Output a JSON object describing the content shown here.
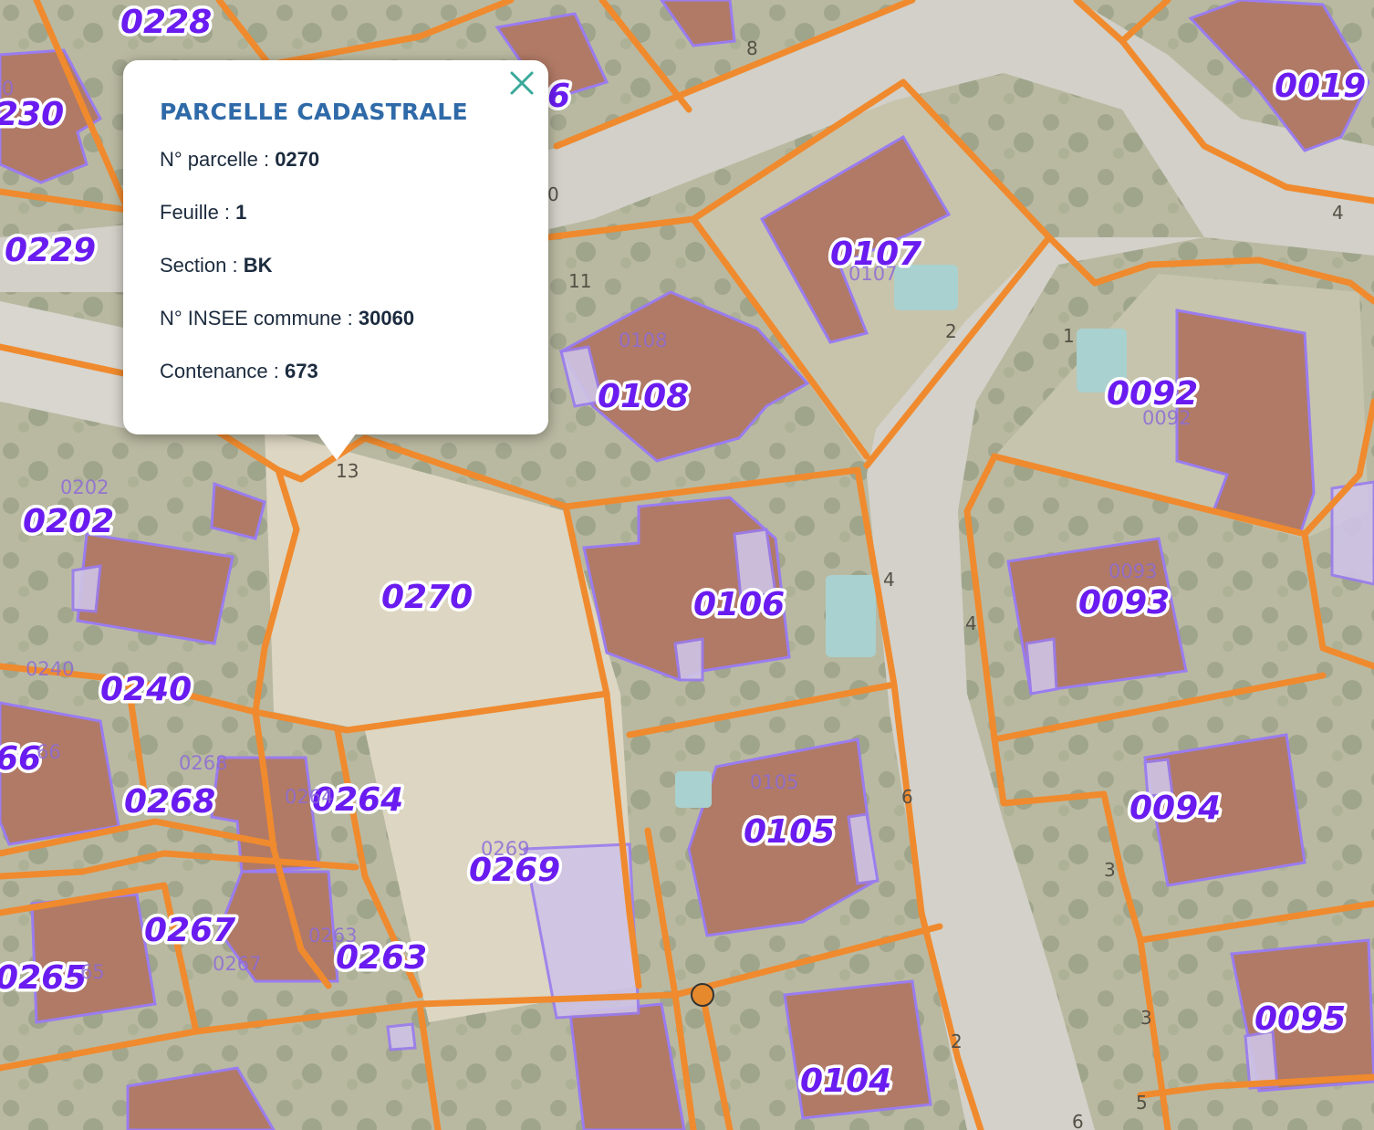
{
  "popup": {
    "title": "PARCELLE CADASTRALE",
    "close_icon": "close-icon",
    "fields": [
      {
        "label": "N° parcelle",
        "sep": " : ",
        "value": "0270"
      },
      {
        "label": "Feuille",
        "sep": " : ",
        "value": "1"
      },
      {
        "label": "Section",
        "sep": " : ",
        "value": "BK"
      },
      {
        "label": "N° INSEE commune",
        "sep": " : ",
        "value": "30060"
      },
      {
        "label": "Contenance",
        "sep": " : ",
        "value": "673"
      }
    ],
    "accent_color": "#2f6aa8",
    "close_color": "#3aa99a"
  },
  "map": {
    "parcel_boundary_color": "#f08a2e",
    "building_outline_color": "#9a7cf0",
    "parcel_label_color": "#6a1cf0",
    "parcel_labels": [
      "0228",
      "230",
      "0229",
      "0019",
      "0107",
      "0108",
      "0092",
      "0202",
      "0270",
      "0106",
      "0093",
      "0240",
      "66",
      "0268",
      "0264",
      "0269",
      "0105",
      "0094",
      "0267",
      "0263",
      "0265",
      "0095",
      "0104",
      "6"
    ],
    "secondary_labels": [
      "0107",
      "0108",
      "0092",
      "0202",
      "0093",
      "0105",
      "0269",
      "0263",
      "0267",
      "0268",
      "0264",
      "66",
      "0240",
      "65",
      "0"
    ],
    "address_numbers": [
      "8",
      "11",
      "0",
      "2",
      "1",
      "4",
      "13",
      "4",
      "6",
      "2",
      "4",
      "3",
      "5",
      "3",
      "6"
    ]
  }
}
